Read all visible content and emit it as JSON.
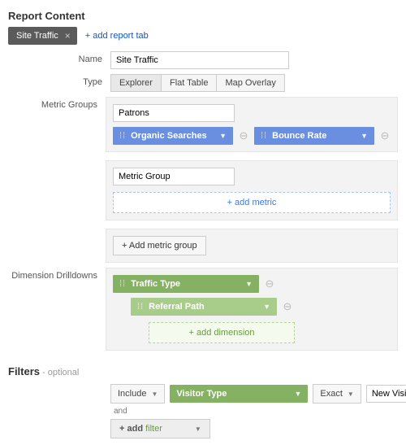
{
  "header": {
    "title": "Report Content"
  },
  "tabs": {
    "active": {
      "label": "Site Traffic"
    },
    "add_label": "+ add report tab"
  },
  "rows": {
    "name": {
      "label": "Name",
      "value": "Site Traffic"
    },
    "type": {
      "label": "Type",
      "options": [
        "Explorer",
        "Flat Table",
        "Map Overlay"
      ],
      "active": "Explorer"
    },
    "metric_groups": {
      "label": "Metric Groups",
      "group1": {
        "name": "Patrons",
        "metrics": [
          "Organic Searches",
          "Bounce Rate"
        ]
      },
      "group2": {
        "name_placeholder": "Metric Group",
        "add_metric_label": "+ add metric"
      },
      "add_group_label": "+ Add metric group"
    },
    "dimensions": {
      "label": "Dimension Drilldowns",
      "d1": "Traffic Type",
      "d2": "Referral Path",
      "add_label": "+ add dimension"
    }
  },
  "filters": {
    "header": "Filters",
    "optional": " - optional",
    "include_label": "Include",
    "field": "Visitor Type",
    "match": "Exact",
    "value": "New Visitor",
    "and": "and",
    "add_prefix": "+ add ",
    "add_word": "filter"
  }
}
